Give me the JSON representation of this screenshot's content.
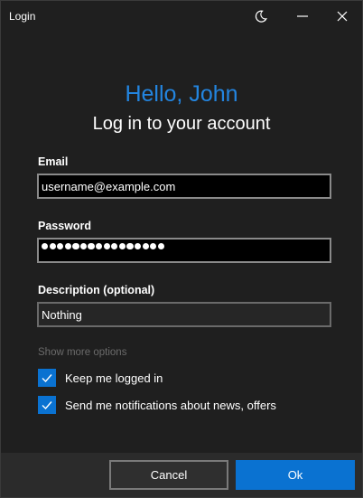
{
  "window": {
    "title": "Login"
  },
  "header": {
    "greeting": "Hello, John",
    "subtitle": "Log in to your account"
  },
  "form": {
    "email": {
      "label": "Email",
      "value": "username@example.com"
    },
    "password": {
      "label": "Password",
      "masked_length": 16
    },
    "description": {
      "label": "Description (optional)",
      "value": "Nothing"
    },
    "more_options_label": "Show more options",
    "checkboxes": [
      {
        "label": "Keep me logged in",
        "checked": true
      },
      {
        "label": "Send me notifications about news, offers",
        "checked": true
      }
    ]
  },
  "footer": {
    "cancel_label": "Cancel",
    "ok_label": "Ok"
  },
  "colors": {
    "accent": "#0a72d1",
    "greeting": "#2385e0",
    "background": "#1f1f1f",
    "footer": "#2b2b2b"
  },
  "icons": {
    "theme": "moon-icon",
    "minimize": "minimize-icon",
    "close": "close-icon",
    "check": "checkmark-icon"
  }
}
